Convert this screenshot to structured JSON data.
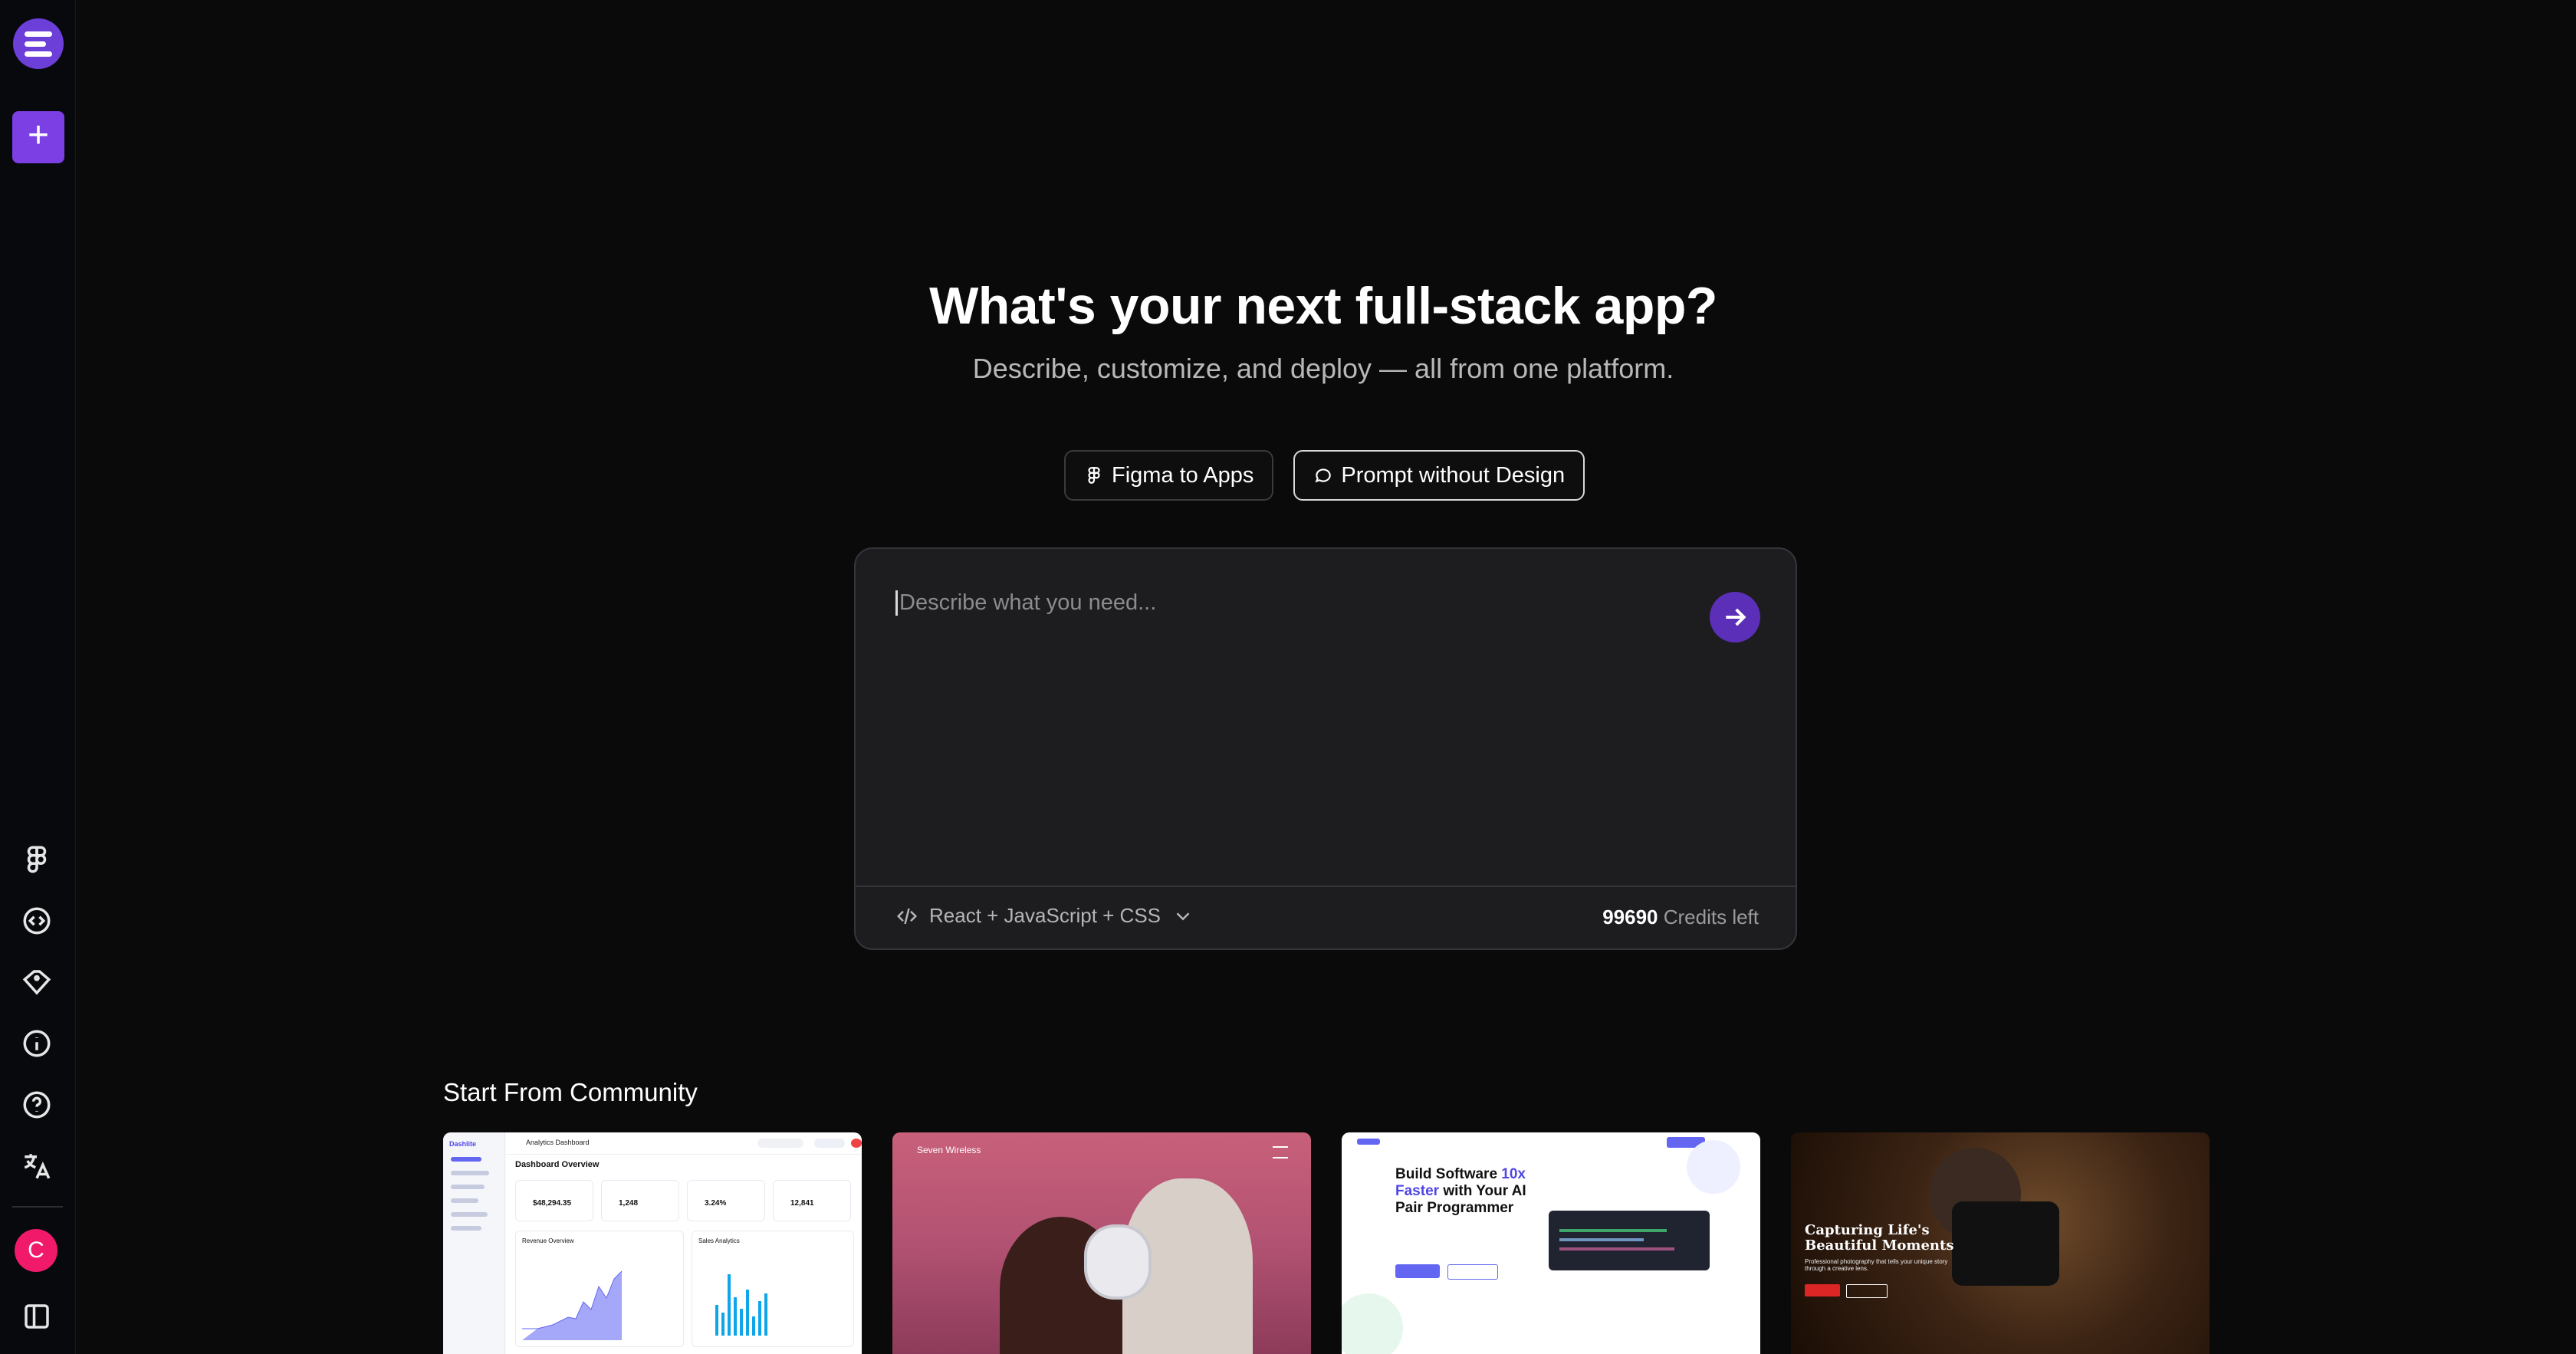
{
  "sidebar": {
    "new_label": "+",
    "icons": [
      "figma-icon",
      "code-circle-icon",
      "tag-icon",
      "info-icon",
      "help-icon",
      "translate-icon"
    ],
    "avatar_initial": "C",
    "toggle_icon": "panel-toggle-icon"
  },
  "hero": {
    "title": "What's your next full-stack app?",
    "subtitle": "Describe, customize, and deploy — all from one platform."
  },
  "modes": [
    {
      "label": "Figma to Apps",
      "icon": "figma-icon",
      "active": false
    },
    {
      "label": "Prompt without Design",
      "icon": "chat-icon",
      "active": true
    }
  ],
  "prompt": {
    "placeholder": "Describe what you need...",
    "stack": "React + JavaScript + CSS",
    "credits_value": "99690",
    "credits_label": "Credits left"
  },
  "community": {
    "title": "Start From Community",
    "cards": [
      {
        "brand": "Dashlite",
        "header": "Analytics Dashboard",
        "heading": "Dashboard Overview",
        "stats": [
          "$48,294.35",
          "1,248",
          "3.24%",
          "12,841"
        ],
        "panels": [
          "Revenue Overview",
          "Sales Analytics"
        ]
      },
      {
        "brand": "Seven Wireless"
      },
      {
        "headline_1": "Build Software",
        "highlight": "10x",
        "headline_2": "Faster",
        "headline_3": "with Your AI Pair Programmer"
      },
      {
        "headline": "Capturing Life's Beautiful Moments",
        "tagline": "Professional photography that tells your unique story through a creative lens."
      }
    ]
  },
  "colors": {
    "accent": "#7b3fe4",
    "send": "#5b2fb7",
    "avatar": "#f0196a",
    "background": "#0a0a0a",
    "card_bg": "#1d1d20"
  }
}
